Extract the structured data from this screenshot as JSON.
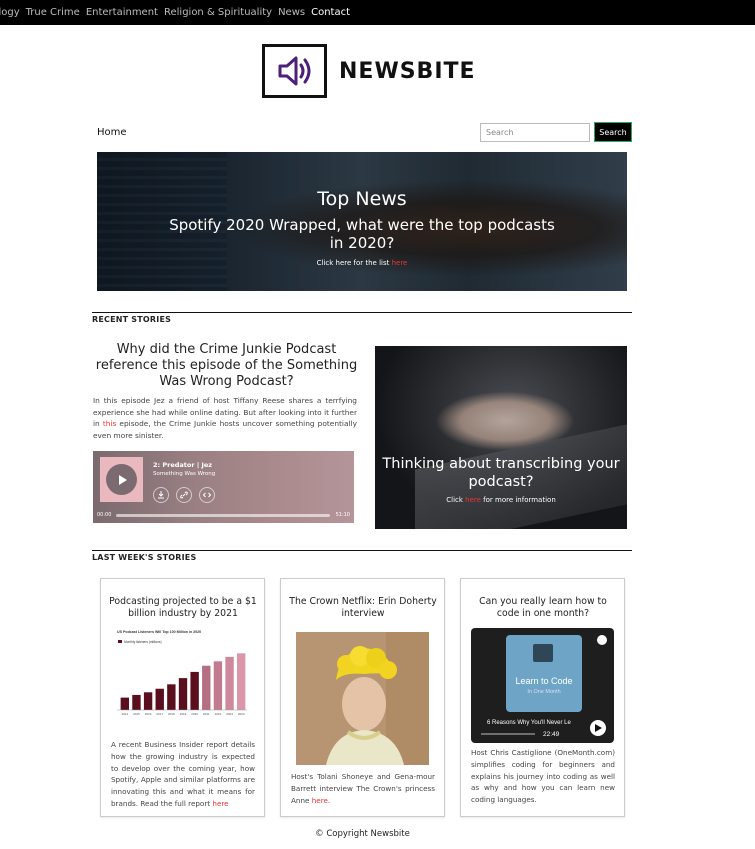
{
  "topnav": {
    "items": [
      "nology",
      "True Crime",
      "Entertainment",
      "Religion & Spirituality",
      "News",
      "Contact"
    ]
  },
  "logo": {
    "text": "NEWSBITE",
    "icon": "speaker-icon"
  },
  "nav": {
    "home": "Home",
    "search_placeholder": "Search",
    "search_button": "Search"
  },
  "hero": {
    "title": "Top News",
    "subtitle": "Spotify 2020 Wrapped, what were the top podcasts in 2020?",
    "link_prefix": "Click here for the list ",
    "link_text": "here"
  },
  "recent": {
    "heading": "RECENT STORIES",
    "story": {
      "title": "Why did the Crime Junkie Podcast reference this episode of the Something Was Wrong Podcast?",
      "text_before": "In this episode Jez a friend of host Tiffany Reese shares a terrfying experience she had while online dating. But after looking into it further in ",
      "link": "this",
      "text_after": " episode, the Crime Junkie hosts uncover something potentially even more sinister."
    },
    "player": {
      "title": "2: Predator | Jez",
      "show": "Something Was Wrong",
      "time_start": "00:00",
      "time_end": "51:10"
    },
    "transcribe": {
      "title": "Thinking about transcribing your podcast?",
      "link_prefix": "Click ",
      "link_text": "here",
      "link_suffix": " for more information"
    }
  },
  "last_week": {
    "heading": "LAST WEEK'S STORIES",
    "cards": [
      {
        "title": "Podcasting projected to be a $1 billion industry by 2021",
        "text": "A recent Business Insider report details how the growing industry is expected to develop over the coming year, how Spotify, Apple and similar platforms are innovating this and what it means for brands. Read the full report ",
        "link": "here"
      },
      {
        "title": "The Crown Netflix: Erin Doherty interview",
        "text": "Host's Tolani Shoneye and Gena-mour Barrett interview The Crown's princess Anne ",
        "link": "here."
      },
      {
        "title": "Can you really learn how to code in one month?",
        "text": "Host Chris Castiglione (OneMonth.com) simplifies coding for beginners and explains his journey into coding as well as why and how you can learn new coding languages.",
        "video": {
          "title": "Learn to Code",
          "subtitle": "In One Month",
          "caption": "6 Reasons Why You'll Never Le",
          "time": "22:49"
        }
      }
    ]
  },
  "chart_data": {
    "type": "bar",
    "title": "US Podcast Listeners Will Top 100 Million in 2020",
    "categories": [
      "2014",
      "2015",
      "2016",
      "2017",
      "2018",
      "2019",
      "2020",
      "2021",
      "2022",
      "2023",
      "2024"
    ],
    "values": [
      14,
      17,
      20,
      24,
      29,
      36,
      43,
      50,
      55,
      60,
      64
    ],
    "series_label": "Monthly listeners (millions)"
  },
  "footer": {
    "text": "© Copyright Newsbite"
  }
}
